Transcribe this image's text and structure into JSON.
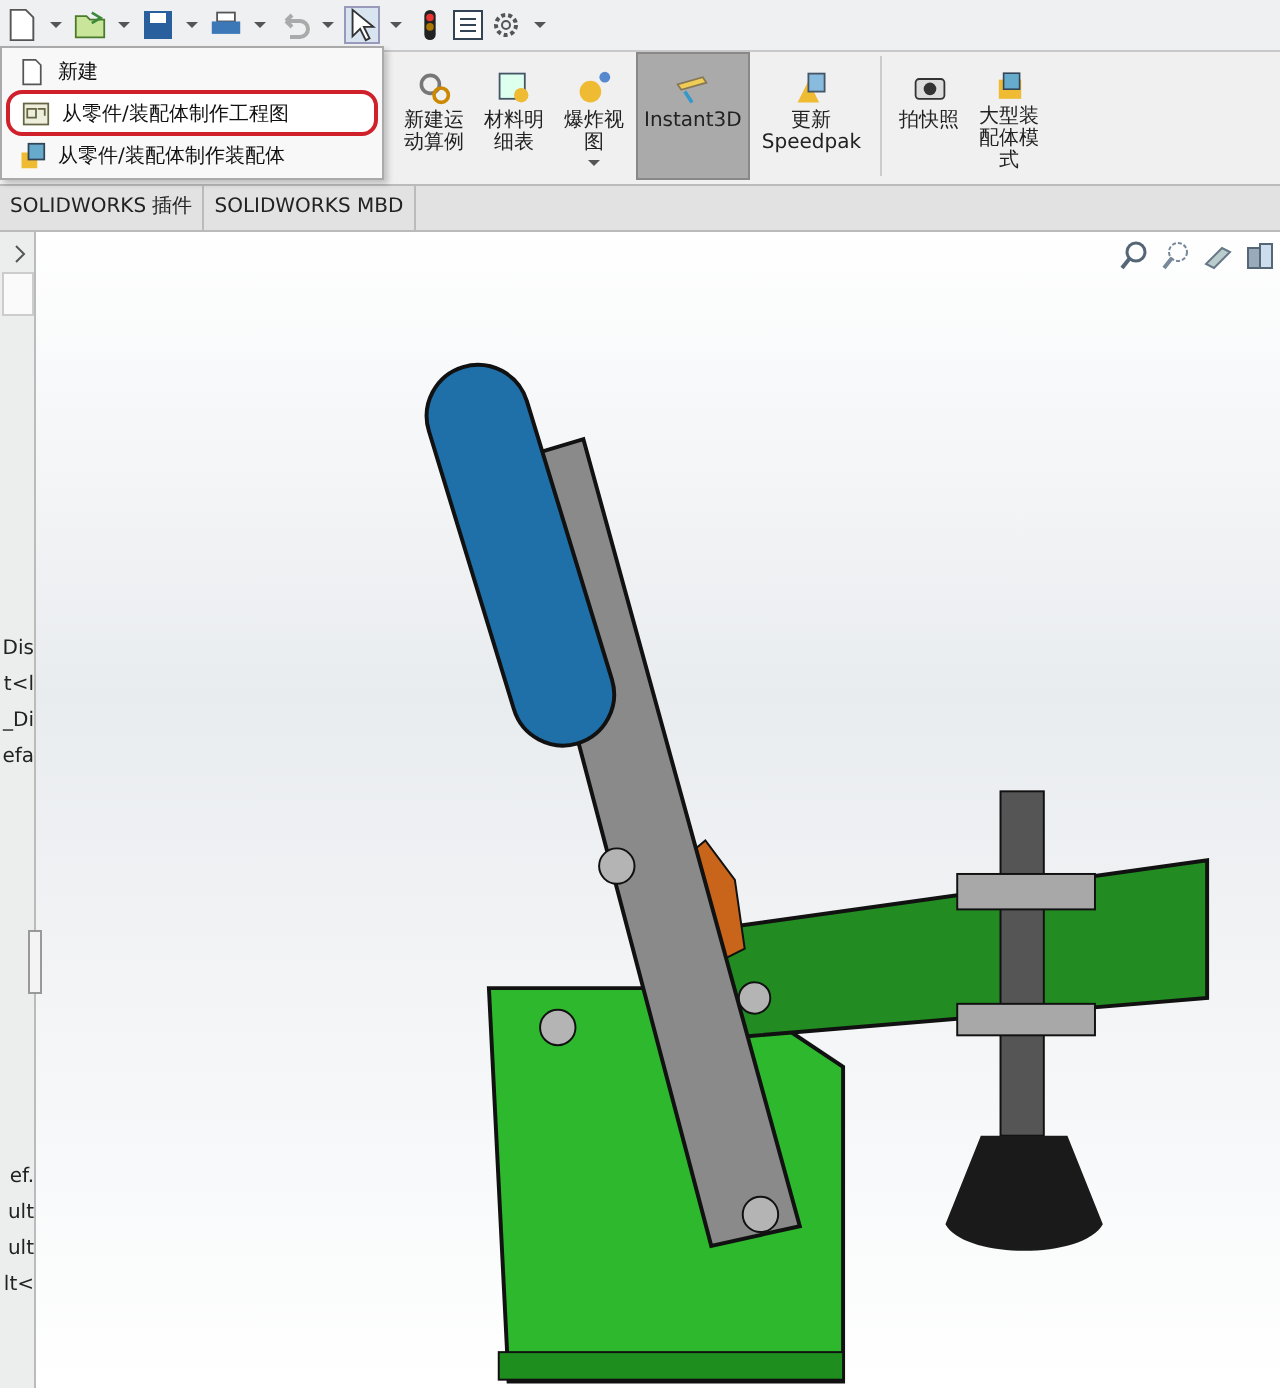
{
  "menu": {
    "items": [
      {
        "label": "新建",
        "kind": "doc",
        "selected": false
      },
      {
        "label": "从零件/装配体制作工程图",
        "kind": "drawing",
        "selected": true
      },
      {
        "label": "从零件/装配体制作装配体",
        "kind": "assembly",
        "selected": false
      }
    ]
  },
  "ribbon": {
    "buttons": [
      {
        "label": "新建运动算例",
        "kind": "motion",
        "selected": false,
        "caret": false
      },
      {
        "label": "材料明细表",
        "kind": "bom",
        "selected": false,
        "caret": false
      },
      {
        "label": "爆炸视图",
        "kind": "explode",
        "selected": false,
        "caret": true
      },
      {
        "label": "Instant3D",
        "kind": "instant",
        "selected": true,
        "caret": false
      },
      {
        "label": "更新\nSpeedpak",
        "kind": "speedpak",
        "selected": false,
        "caret": false
      },
      {
        "label": "拍快照",
        "kind": "camera",
        "selected": false,
        "caret": false
      },
      {
        "label": "大型装配体模式",
        "kind": "large",
        "selected": false,
        "caret": false
      }
    ]
  },
  "tabs": [
    {
      "label": "SOLIDWORKS 插件"
    },
    {
      "label": "SOLIDWORKS MBD"
    }
  ],
  "tree": {
    "upper": [
      "Dis",
      "t<l",
      "_Di",
      "efa"
    ],
    "lower": [
      "ef.",
      "ult",
      "ult",
      "lt<"
    ]
  }
}
